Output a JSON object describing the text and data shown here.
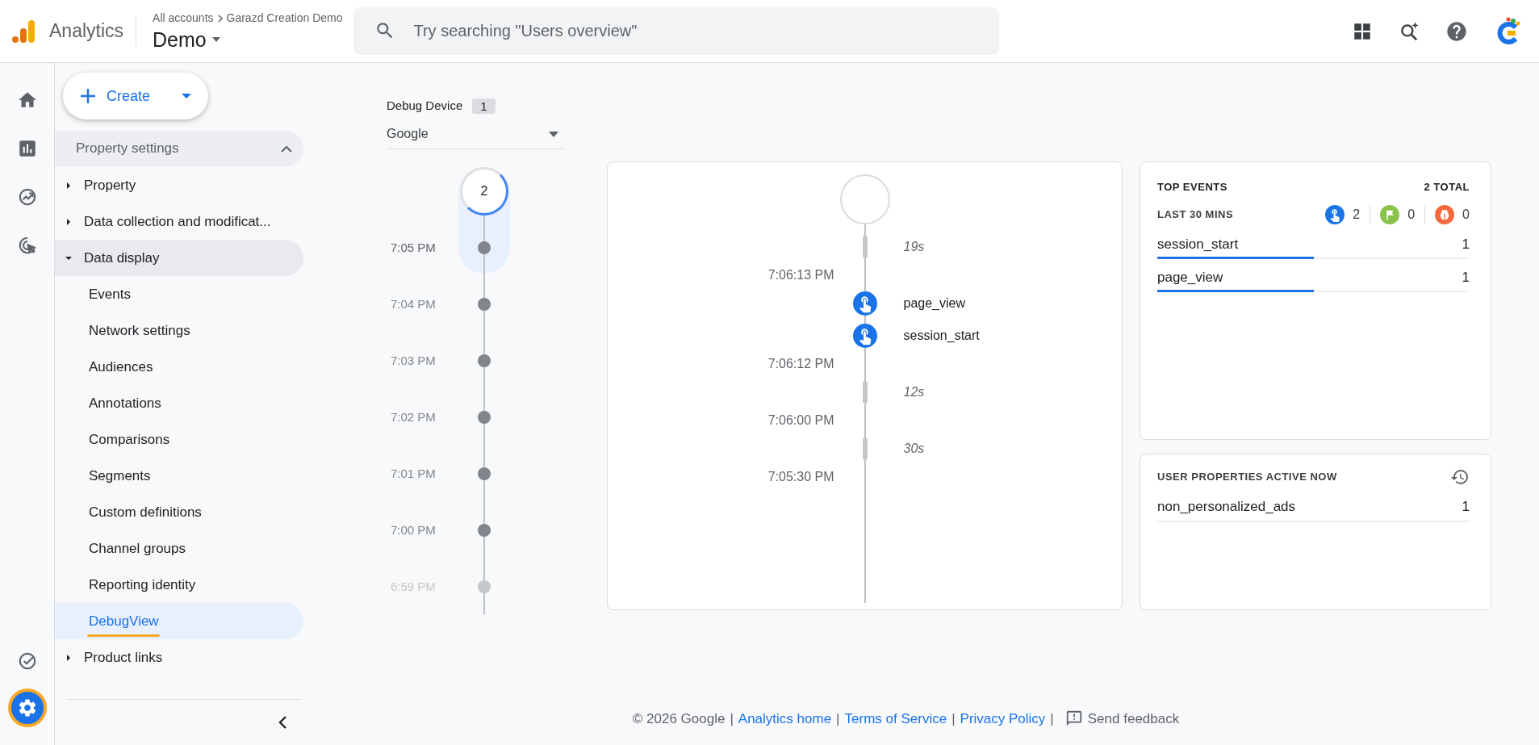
{
  "header": {
    "product": "Analytics",
    "breadcrumb": [
      "All accounts",
      "Garazd Creation Demo"
    ],
    "property": "Demo",
    "search": {
      "placeholder": "Try searching \"Users overview\""
    }
  },
  "rail": [
    {
      "kind": "home",
      "selected": false
    },
    {
      "kind": "reports",
      "selected": false
    },
    {
      "kind": "explore",
      "selected": false
    },
    {
      "kind": "advertising",
      "selected": false
    },
    {
      "kind": "check",
      "selected": false
    },
    {
      "kind": "settings",
      "selected": true
    }
  ],
  "sidebar": {
    "create_button": "Create",
    "section": {
      "label": "Property settings",
      "expanded": true
    },
    "items": [
      {
        "label": "Property",
        "expanded": false
      },
      {
        "label": "Data collection and modificat...",
        "expanded": false
      },
      {
        "label": "Data display",
        "expanded": true,
        "children": [
          {
            "label": "Events",
            "selected": false
          },
          {
            "label": "Network settings",
            "selected": false
          },
          {
            "label": "Audiences",
            "selected": false
          },
          {
            "label": "Annotations",
            "selected": false
          },
          {
            "label": "Comparisons",
            "selected": false
          },
          {
            "label": "Segments",
            "selected": false
          },
          {
            "label": "Custom definitions",
            "selected": false
          },
          {
            "label": "Channel groups",
            "selected": false
          },
          {
            "label": "Reporting identity",
            "selected": false
          },
          {
            "label": "DebugView",
            "selected": true
          }
        ]
      },
      {
        "label": "Product links",
        "expanded": false
      }
    ]
  },
  "debug_device": {
    "label": "Debug Device",
    "count": "1",
    "value": "Google"
  },
  "minutes": {
    "count": "2",
    "rows": [
      {
        "time": "7:05 PM",
        "selected": true
      },
      {
        "time": "7:04 PM",
        "selected": false
      },
      {
        "time": "7:03 PM",
        "selected": false
      },
      {
        "time": "7:02 PM",
        "selected": false
      },
      {
        "time": "7:01 PM",
        "selected": false
      },
      {
        "time": "7:00 PM",
        "selected": false
      },
      {
        "time": "6:59 PM",
        "selected": false
      }
    ]
  },
  "seconds": [
    {
      "kind": "gap",
      "label": "19s"
    },
    {
      "kind": "time",
      "label": "7:06:13 PM"
    },
    {
      "kind": "event",
      "label": "page_view"
    },
    {
      "kind": "event",
      "label": "session_start"
    },
    {
      "kind": "time",
      "label": "7:06:12 PM"
    },
    {
      "kind": "gap",
      "label": "12s"
    },
    {
      "kind": "time",
      "label": "7:06:00 PM"
    },
    {
      "kind": "gap",
      "label": "30s"
    },
    {
      "kind": "time",
      "label": "7:05:30 PM"
    }
  ],
  "top_events": {
    "title": "TOP EVENTS",
    "total": "2 TOTAL",
    "period": "LAST 30 MINS",
    "counters": [
      {
        "kind": "event",
        "count": "2",
        "color": "#1a73e8"
      },
      {
        "kind": "conversion",
        "count": "0",
        "color": "#8bc34a"
      },
      {
        "kind": "error",
        "count": "0",
        "color": "#f4693e"
      }
    ],
    "rows": [
      {
        "name": "session_start",
        "count": "1",
        "level": 0.5
      },
      {
        "name": "page_view",
        "count": "1",
        "level": 0.5
      }
    ]
  },
  "user_properties": {
    "title": "USER PROPERTIES ACTIVE NOW",
    "rows": [
      {
        "name": "non_personalized_ads",
        "count": "1"
      }
    ]
  },
  "footer": [
    {
      "kind": "text",
      "label": "© 2026 Google"
    },
    {
      "kind": "separator",
      "label": "|"
    },
    {
      "kind": "link",
      "label": "Analytics home"
    },
    {
      "kind": "separator",
      "label": "|"
    },
    {
      "kind": "link",
      "label": "Terms of Service"
    },
    {
      "kind": "separator",
      "label": "|"
    },
    {
      "kind": "link",
      "label": "Privacy Policy"
    },
    {
      "kind": "separator",
      "label": "|"
    },
    {
      "kind": "feedback",
      "label": "Send feedback"
    }
  ]
}
